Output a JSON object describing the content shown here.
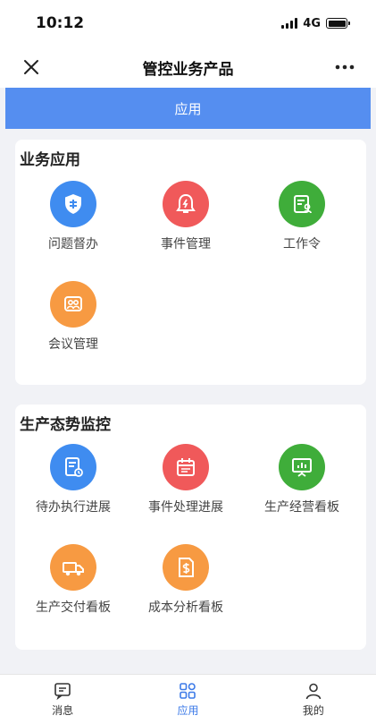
{
  "status_bar": {
    "time": "10:12",
    "network": "4G",
    "battery_level": 1.0
  },
  "navbar": {
    "title": "管控业务产品",
    "close_icon": "close-icon",
    "more_icon": "more-icon"
  },
  "banner": {
    "label": "应用"
  },
  "sections": [
    {
      "title": "业务应用",
      "apps": [
        {
          "label": "问题督办",
          "icon": "shield-supervise-icon",
          "color": "#3f8cf0"
        },
        {
          "label": "事件管理",
          "icon": "alarm-bell-icon",
          "color": "#f0595a"
        },
        {
          "label": "工作令",
          "icon": "work-order-icon",
          "color": "#3fad3a"
        },
        {
          "label": "会议管理",
          "icon": "meeting-icon",
          "color": "#f79a42"
        }
      ]
    },
    {
      "title": "生产态势监控",
      "apps": [
        {
          "label": "待办执行进展",
          "icon": "task-progress-icon",
          "color": "#3f8cf0"
        },
        {
          "label": "事件处理进展",
          "icon": "calendar-icon",
          "color": "#f0595a"
        },
        {
          "label": "生产经营看板",
          "icon": "presentation-board-icon",
          "color": "#3fad3a"
        },
        {
          "label": "生产交付看板",
          "icon": "delivery-truck-icon",
          "color": "#f79a42"
        },
        {
          "label": "成本分析看板",
          "icon": "cost-document-icon",
          "color": "#f79a42"
        }
      ]
    }
  ],
  "tabbar": {
    "items": [
      {
        "label": "消息",
        "icon": "message-icon"
      },
      {
        "label": "应用",
        "icon": "apps-grid-icon",
        "active": true
      },
      {
        "label": "我的",
        "icon": "profile-icon"
      }
    ],
    "active_color": "#3d7be8"
  }
}
